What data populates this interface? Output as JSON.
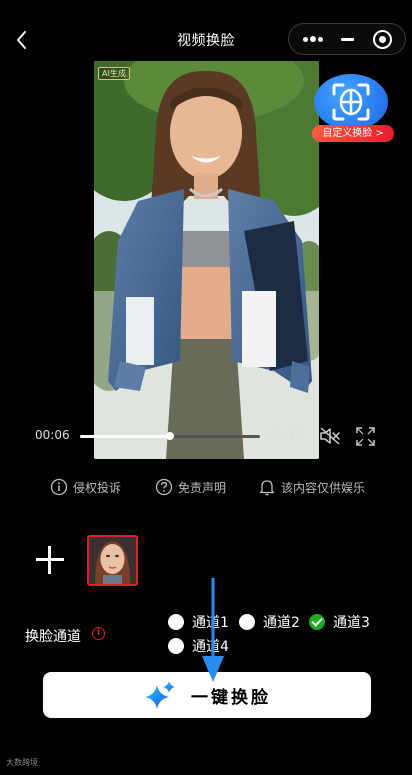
{
  "header": {
    "title": "视频换脸",
    "back_icon": "chevron-left-icon",
    "more_icon": "more-dots-icon",
    "minimize_icon": "minus-icon",
    "close_icon": "target-circle-icon"
  },
  "video": {
    "ai_badge": "AI生成",
    "current_time": "00:06",
    "total_time": "00:15",
    "progress": 0.5,
    "mute_icon": "speaker-muted-icon",
    "fullscreen_icon": "fullscreen-icon"
  },
  "custom_face": {
    "label": "自定义换脸 >",
    "icon": "face-scan-icon"
  },
  "info": [
    {
      "label": "侵权投诉",
      "icon": "info-circle-icon"
    },
    {
      "label": "免责声明",
      "icon": "question-circle-icon"
    },
    {
      "label": "该内容仅供娱乐",
      "icon": "bell-icon"
    }
  ],
  "face_select": {
    "add_icon": "plus-icon",
    "thumbnail_alt": "selected-face"
  },
  "channels": {
    "label": "换脸通道",
    "options": [
      {
        "label": "通道1",
        "checked": false
      },
      {
        "label": "通道2",
        "checked": false
      },
      {
        "label": "通道3",
        "checked": true
      },
      {
        "label": "通道4",
        "checked": false
      }
    ]
  },
  "action": {
    "label": "一键换脸",
    "icon": "sparkle-icon"
  },
  "watermark": "大数跨境",
  "colors": {
    "background": "#000000",
    "accent_red": "#e02020",
    "checked_green": "#19ad19",
    "badge_blue": "#1a63e6",
    "arrow_blue": "#2a8cf0"
  }
}
